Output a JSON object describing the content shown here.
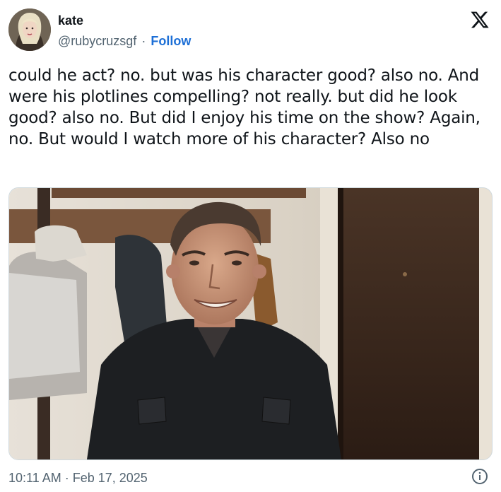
{
  "author": {
    "display_name": "kate",
    "handle": "@rubycruzsgf",
    "separator": "·",
    "follow_label": "Follow"
  },
  "tweet": {
    "text": "could he act? no. but was his character good? also no. And were his plotlines compelling? not really. but did he look good? also no. But did I enjoy his time on the show? Again, no. But would I watch more of his character? Also no"
  },
  "footer": {
    "timestamp": "10:11 AM · Feb 17, 2025"
  },
  "icons": {
    "brand": "x-logo-icon",
    "info": "info-icon"
  },
  "colors": {
    "link": "#1d6fd6",
    "secondary_text": "#536471",
    "primary_text": "#0f1419"
  }
}
